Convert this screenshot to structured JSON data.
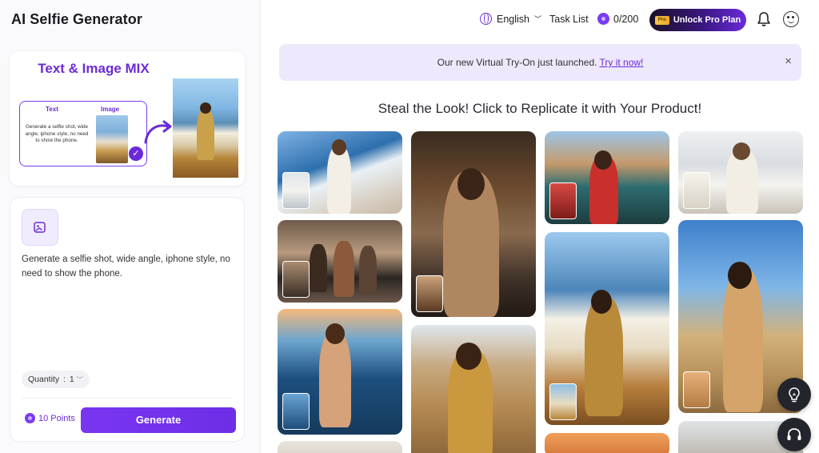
{
  "app": {
    "title": "AI Selfie Generator"
  },
  "promo": {
    "title": "Text & Image MIX",
    "text_header": "Text",
    "image_header": "Image",
    "example_text": "Generate a selfie shot, wide angle, iphone style, no need to show the phone."
  },
  "prompt": {
    "text": "Generate a selfie shot, wide angle, iphone style, no need to show the phone.",
    "quantity_label": "Quantity",
    "quantity_value": "1",
    "points": "10 Points",
    "generate_label": "Generate"
  },
  "header": {
    "language": "English",
    "task_list": "Task List",
    "credits": "0/200",
    "pro_badge": "Pro",
    "pro_label": "Unlock Pro Plan"
  },
  "banner": {
    "text": "Our new Virtual Try-On just launched.",
    "link": "Try it now!",
    "close": "×"
  },
  "gallery": {
    "title": "Steal the Look! Click to Replicate it with Your Product!"
  },
  "colors": {
    "accent": "#6b2bd9",
    "banner_bg": "#ede8fb",
    "fab_bg": "#22252b"
  },
  "icons": [
    "globe-icon",
    "chevron-down-icon",
    "coin-icon",
    "bell-icon",
    "avatar-icon",
    "close-icon",
    "image-upload-icon",
    "check-icon",
    "curved-arrow-icon",
    "lightbulb-icon",
    "headset-icon"
  ]
}
